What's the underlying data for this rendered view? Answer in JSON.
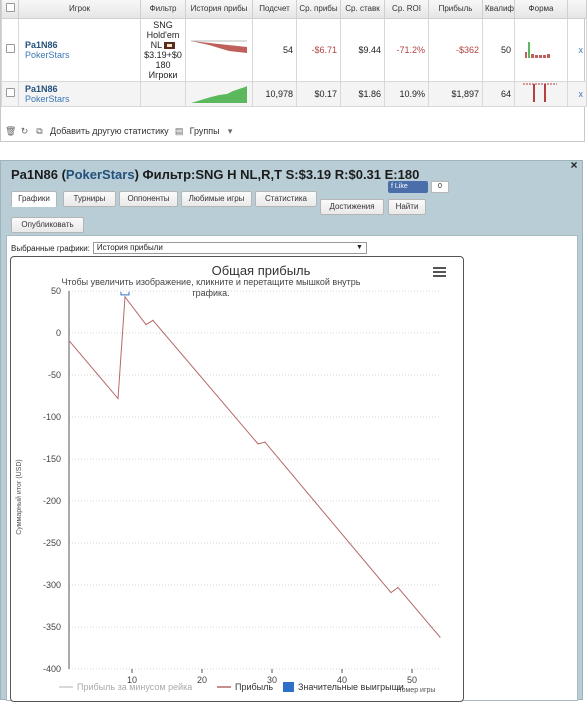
{
  "table": {
    "headers": [
      "Игрок",
      "Фильтр",
      "История прибы",
      "Подсчет",
      "Ср. прибы",
      "Ср. ставк",
      "Ср. ROI",
      "Прибыль",
      "Квалиф",
      "Форма"
    ],
    "rows": [
      {
        "player": "Pa1N86",
        "room": "PokerStars",
        "filter_lines": [
          "SNG",
          "Hold'em",
          "NL",
          "$3.19+$0",
          "180",
          "Игроки"
        ],
        "count": "54",
        "avg_profit": "-$6.71",
        "avg_stake": "$9.44",
        "avg_roi": "-71.2%",
        "profit": "-$362",
        "qualif": "50",
        "x": "x"
      },
      {
        "player": "Pa1N86",
        "room": "PokerStars",
        "count": "10,978",
        "avg_profit": "$0.17",
        "avg_stake": "$1.86",
        "avg_roi": "10.9%",
        "profit": "$1,897",
        "qualif": "64",
        "x": "x"
      }
    ]
  },
  "toolbar": {
    "add_stats": "Добавить другую статистику",
    "groups": "Группы"
  },
  "popup": {
    "title_prefix": "Pa1N86 (",
    "title_room": "PokerStars",
    "title_suffix": ") Фильтр:SNG H NL,R,T S:$3.19 R:$0.31 E:180",
    "close": "×",
    "like_label": "f Like",
    "like_count": "0",
    "tabs": [
      "Графики",
      "Турниры",
      "Оппоненты",
      "Любимые игры",
      "Статистика",
      "Достижения",
      "Найти",
      "Опубликовать"
    ],
    "chooser_label": "Выбранные графики:",
    "chooser_value": "История прибыли"
  },
  "colors": {
    "series_profit": "#b46a6a",
    "series_rake": "#cccccc",
    "series_big": "#2e6fc8",
    "positive_bar": "#5cb85c",
    "negative_bar": "#b24040"
  },
  "chart_data": {
    "type": "line",
    "title": "Общая прибыль",
    "subtitle": "Чтобы увеличить изображение, кликните и перетащите мышкой внутрь графика.",
    "xlabel": "Номер игры",
    "ylabel": "Суммарный итог (USD)",
    "xlim": [
      1,
      54
    ],
    "ylim": [
      -400,
      50
    ],
    "xticks": [
      10,
      20,
      30,
      40,
      50
    ],
    "yticks": [
      50,
      0,
      -50,
      -100,
      -150,
      -200,
      -250,
      -300,
      -350,
      -400
    ],
    "grid": true,
    "legend_position": "bottom",
    "legend": [
      "Прибыль за минусом рейка",
      "Прибыль",
      "Значительные выигрыши"
    ],
    "series": [
      {
        "name": "Прибыль",
        "x": [
          1,
          8,
          9,
          12,
          13,
          28,
          29,
          47,
          48,
          54
        ],
        "y": [
          -9,
          -78,
          43,
          10,
          15,
          -132,
          -130,
          -309,
          -303,
          -362
        ]
      }
    ],
    "markers": [
      {
        "x": 9,
        "y": 43,
        "label": "big-win"
      }
    ]
  }
}
